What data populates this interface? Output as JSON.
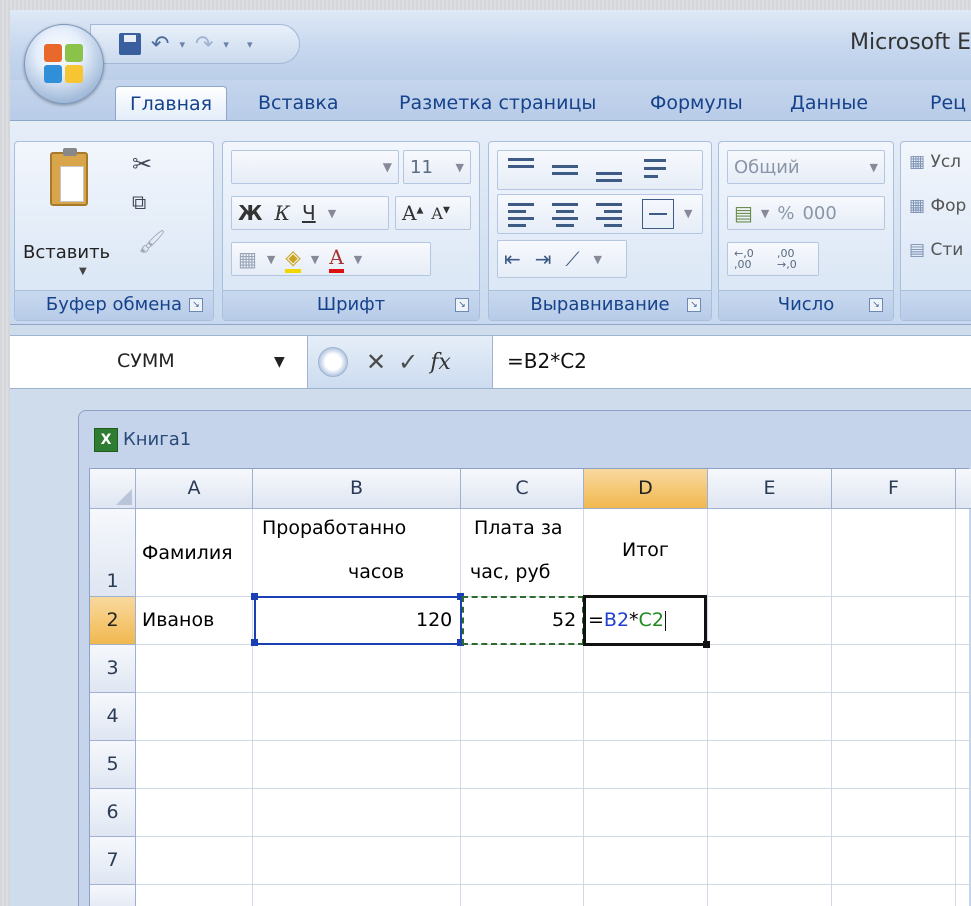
{
  "window": {
    "title": "Microsoft Ex"
  },
  "tabs": [
    "Главная",
    "Вставка",
    "Разметка страницы",
    "Формулы",
    "Данные",
    "Рец"
  ],
  "ribbon": {
    "clipboard": {
      "paste_label": "Вставить",
      "group_label": "Буфер обмена"
    },
    "font": {
      "font_name": "",
      "font_size": "11",
      "bold": "Ж",
      "italic": "К",
      "underline": "Ч",
      "grow": "A",
      "shrink": "A",
      "group_label": "Шрифт"
    },
    "alignment": {
      "group_label": "Выравнивание"
    },
    "number": {
      "format": "Общий",
      "percent": "%",
      "thousands": "000",
      "inc_decimal": "←,0 ,00",
      "dec_decimal": ",00 →,0",
      "group_label": "Число"
    },
    "styles": {
      "conditional": "Усл",
      "format_table": "Фор",
      "cell_styles": "Сти"
    }
  },
  "formula_bar": {
    "name_box": "СУММ",
    "fx": "fx",
    "formula": "=B2*C2"
  },
  "workbook": {
    "name": "Книга1",
    "columns": [
      "A",
      "B",
      "C",
      "D",
      "E",
      "F"
    ],
    "selected_column": "D",
    "selected_row": "2",
    "rows": [
      "1",
      "2",
      "3",
      "4",
      "5",
      "6",
      "7"
    ],
    "cells": {
      "A1": "Фамилия",
      "B1_line1": "Проработанно",
      "B1_line2": "часов",
      "C1_line1": "Плата за",
      "C1_line2": "час, руб",
      "D1": "Итог",
      "A2": "Иванов",
      "B2": "120",
      "C2": "52",
      "D2_eq": "=",
      "D2_ref1": "B2",
      "D2_op": "*",
      "D2_ref2": "C2"
    },
    "colors": {
      "ref_b2": "#1f3fd1",
      "ref_c2": "#1f8a1f",
      "selected_header": "#f1b84f"
    }
  }
}
